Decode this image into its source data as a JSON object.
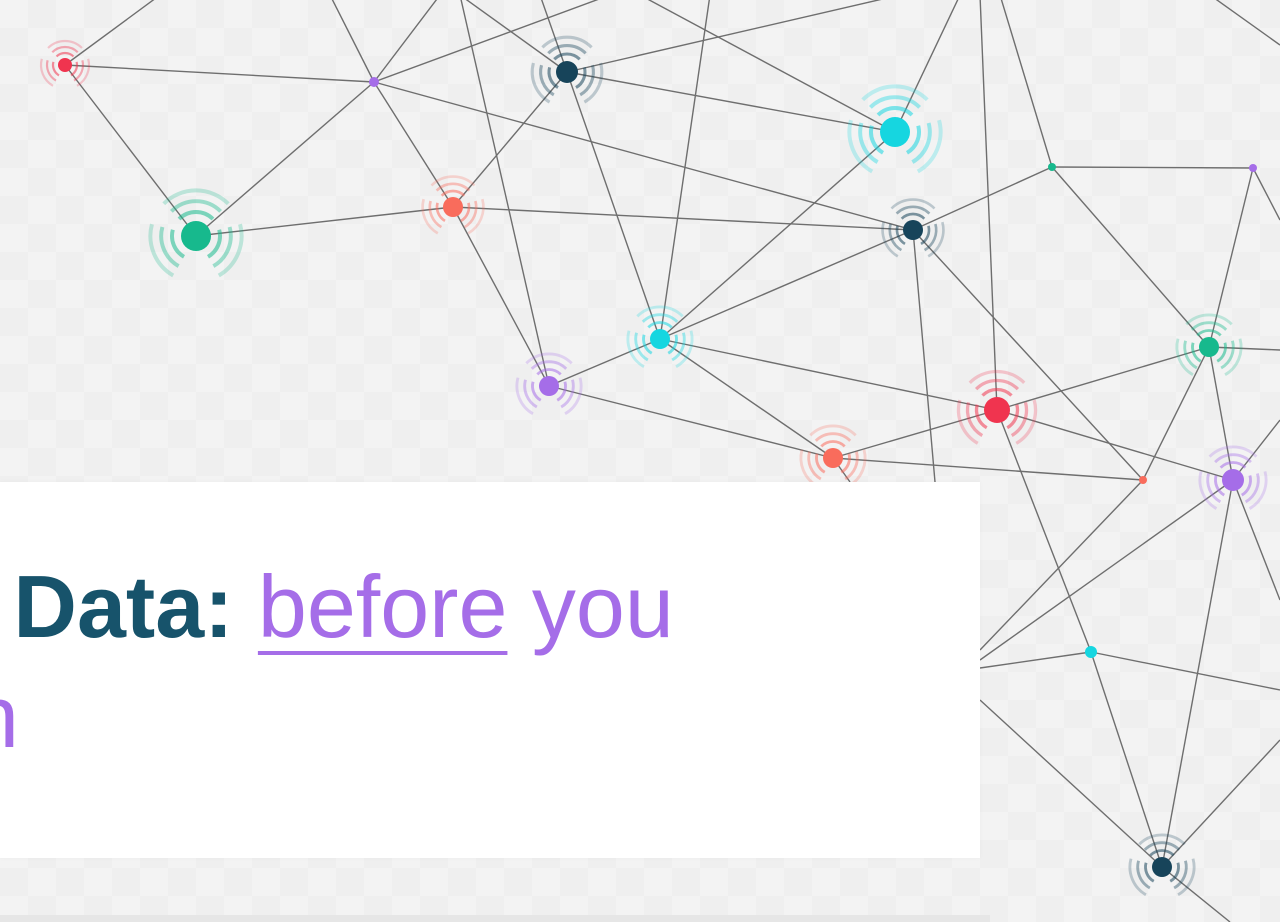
{
  "slide": {
    "title_bold": "k Data:",
    "title_link": "before",
    "title_rest": " you",
    "title_line2": "n"
  },
  "colors": {
    "title_dark": "#17536b",
    "accent_purple": "#a56de8",
    "node_red": "#f0344f",
    "node_navy": "#17445a",
    "node_cyan": "#16d6e0",
    "node_green": "#17b98d",
    "node_orange": "#f96c5c",
    "node_purple": "#a56de8",
    "edge": "#6e6e6e",
    "card_bg": "#ffffff"
  }
}
